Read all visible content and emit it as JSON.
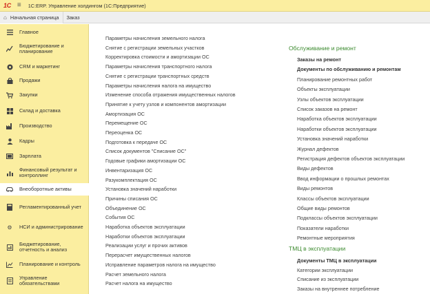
{
  "app": {
    "logo": "1С",
    "title": "1С:ERP. Управление холдингом (1С:Предприятие)"
  },
  "tabs": {
    "home": "Начальная страница",
    "second": "Заказ"
  },
  "sidebar": {
    "items": [
      {
        "label": "Главное",
        "icon": "menu-list-icon"
      },
      {
        "label": "Бюджетирование и планирование",
        "icon": "chart-trend-icon"
      },
      {
        "label": "CRM и маркетинг",
        "icon": "crm-icon"
      },
      {
        "label": "Продажи",
        "icon": "bag-icon"
      },
      {
        "label": "Закупки",
        "icon": "cart-icon"
      },
      {
        "label": "Склад и доставка",
        "icon": "warehouse-icon"
      },
      {
        "label": "Производство",
        "icon": "factory-icon"
      },
      {
        "label": "Кадры",
        "icon": "person-icon"
      },
      {
        "label": "Зарплата",
        "icon": "money-icon"
      },
      {
        "label": "Финансовый результат и контроллинг",
        "icon": "bar-chart-icon"
      },
      {
        "label": "Внеоборотные активы",
        "icon": "car-icon"
      },
      {
        "label": "Регламентированный учет",
        "icon": "calculator-icon"
      },
      {
        "label": "НСИ и администрирование",
        "icon": "gear-icon"
      },
      {
        "label": "Бюджетирование, отчетность и анализ",
        "icon": "report-icon"
      },
      {
        "label": "Планирование и контроль",
        "icon": "planning-icon"
      },
      {
        "label": "Управление обязательствами",
        "icon": "obligations-icon"
      }
    ]
  },
  "column1": {
    "links": [
      "Параметры начисления земельного налога",
      "Снятие с регистрации земельных участков",
      "Корректировка стоимости и амортизации ОС",
      "Параметры начисления транспортного налога",
      "Снятие с регистрации транспортных средств",
      "Параметры начисления налога на имущество",
      "Изменение способа отражения имущественных налогов",
      "Принятие к учету узлов и компонентов амортизации",
      "Амортизация ОС",
      "Перемещение ОС",
      "Переоценка ОС",
      "Подготовка к передаче ОС",
      "Список документов \"Списание ОС\"",
      "Годовые графики амортизации ОС",
      "Инвентаризация ОС",
      "Разукомплектация ОС",
      "Установка значений наработки",
      "Причины списания ОС",
      "Объединение ОС",
      "События ОС",
      "Наработка объектов эксплуатации",
      "Наработки объектов эксплуатации",
      "Реализации услуг и прочих активов",
      "Перерасчет имущественных налогов",
      "Исправление параметров налога на имущество",
      "Расчет земельного налога",
      "Расчет налога на имущество"
    ]
  },
  "section_maintenance": {
    "title": "Обслуживание и ремонт",
    "links": [
      {
        "label": "Заказы на ремонт",
        "bold": true
      },
      {
        "label": "Документы по обслуживанию и ремонтам",
        "bold": true
      },
      {
        "label": "Планирование ремонтных работ",
        "bold": false
      },
      {
        "label": "Объекты эксплуатации",
        "bold": false
      },
      {
        "label": "Узлы объектов эксплуатации",
        "bold": false
      },
      {
        "label": "Список заказов на ремонт",
        "bold": false
      },
      {
        "label": "Наработка объектов эксплуатации",
        "bold": false
      },
      {
        "label": "Наработки объектов эксплуатации",
        "bold": false
      },
      {
        "label": "Установка значений наработки",
        "bold": false
      },
      {
        "label": "Журнал дефектов",
        "bold": false
      },
      {
        "label": "Регистрация дефектов объектов эксплуатации",
        "bold": false
      },
      {
        "label": "Виды дефектов",
        "bold": false
      },
      {
        "label": "Ввод информации о прошлых ремонтах",
        "bold": false
      },
      {
        "label": "Виды ремонтов",
        "bold": false
      },
      {
        "label": "Классы объектов эксплуатации",
        "bold": false
      },
      {
        "label": "Общие виды ремонтов",
        "bold": false
      },
      {
        "label": "Подклассы объектов эксплуатации",
        "bold": false
      },
      {
        "label": "Показатели наработки",
        "bold": false
      },
      {
        "label": "Ремонтные мероприятия",
        "bold": false
      }
    ]
  },
  "section_tmc": {
    "title": "ТМЦ в эксплуатации",
    "links": [
      {
        "label": "Документы ТМЦ в эксплуатации",
        "bold": true
      },
      {
        "label": "Категории эксплуатации",
        "bold": false
      },
      {
        "label": "Списание из эксплуатации",
        "bold": false
      },
      {
        "label": "Заказы на внутреннее потребление",
        "bold": false
      }
    ]
  },
  "colors": {
    "sidebar_bg": "#fbeea0",
    "section_title": "#3b8a2e",
    "logo_red": "#d0241c"
  }
}
